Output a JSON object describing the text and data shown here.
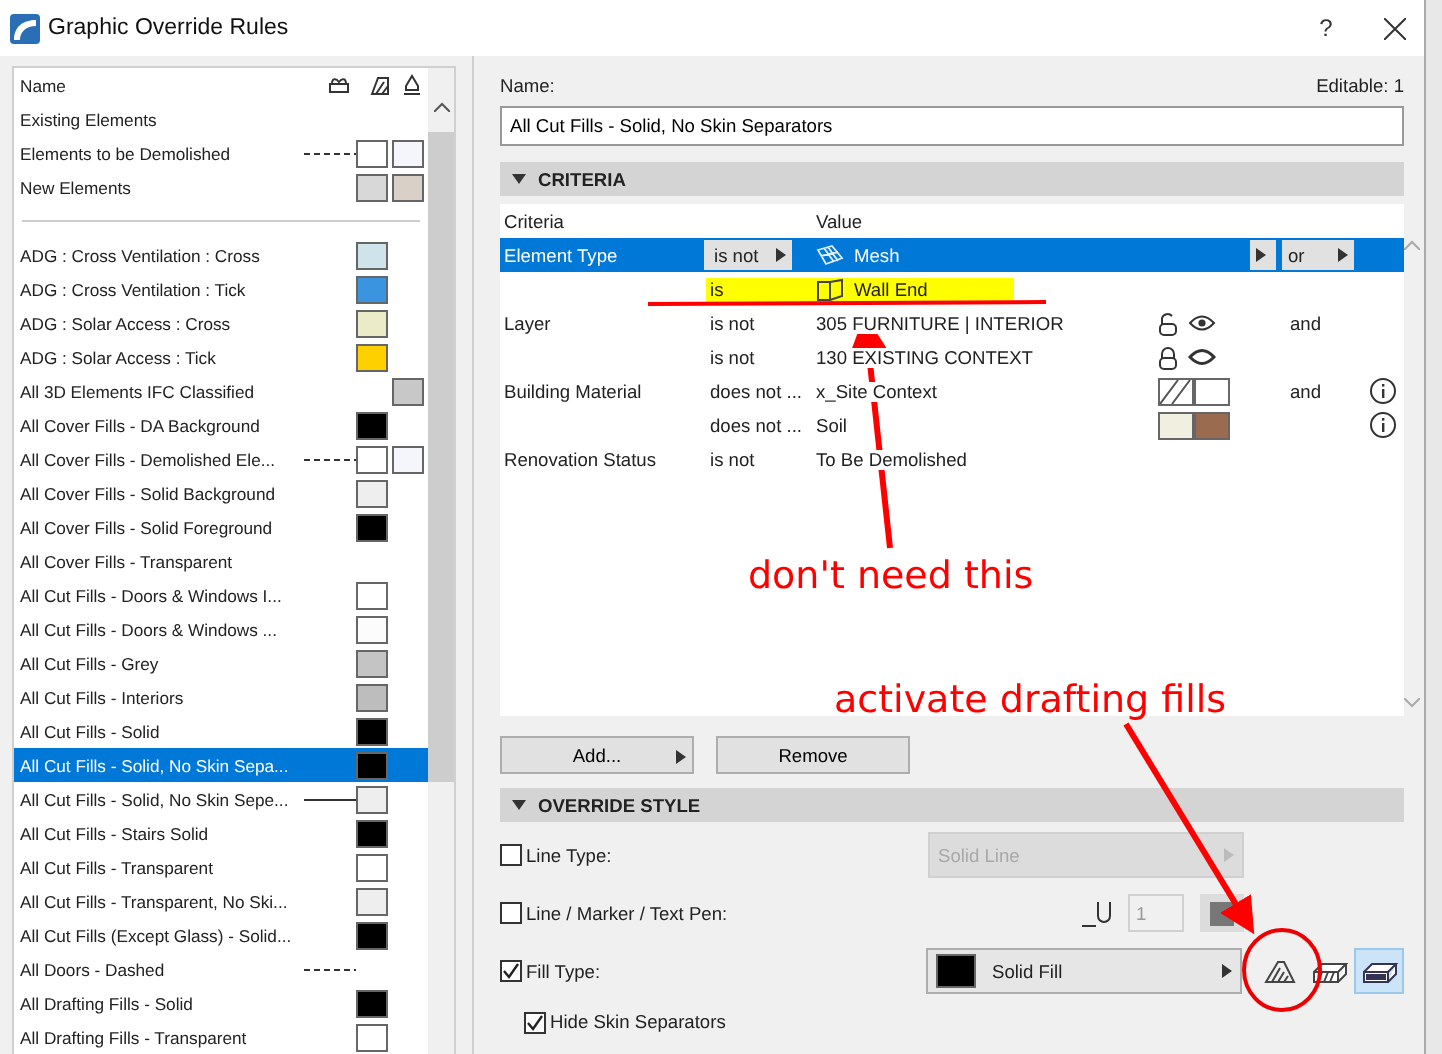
{
  "window": {
    "title": "Graphic Override Rules",
    "help": "?"
  },
  "rules_list": {
    "name_header": "Name",
    "items": [
      {
        "kind": "rule",
        "name": "Existing Elements",
        "selected": false
      },
      {
        "kind": "rule-dashed",
        "name": "Elements to be Demolished",
        "selected": false,
        "fills": [
          {
            "color": "#ffffff"
          },
          {
            "color": "#f4f6fb"
          }
        ]
      },
      {
        "kind": "rule",
        "name": "New Elements",
        "selected": false,
        "fills": [
          {
            "color": "#d8d8d8"
          },
          {
            "color": "#d9d0c8"
          }
        ]
      },
      {
        "kind": "separator"
      },
      {
        "kind": "rule",
        "name": "ADG : Cross Ventilation : Cross",
        "selected": false,
        "fills": [
          {
            "color": "#cfe3ea"
          }
        ]
      },
      {
        "kind": "rule",
        "name": "ADG : Cross Ventilation : Tick",
        "selected": false,
        "fills": [
          {
            "color": "#3a94e0"
          }
        ]
      },
      {
        "kind": "rule",
        "name": "ADG : Solar Access : Cross",
        "selected": false,
        "fills": [
          {
            "color": "#ecebc8"
          }
        ]
      },
      {
        "kind": "rule",
        "name": "ADG : Solar Access : Tick",
        "selected": false,
        "fills": [
          {
            "color": "#ffd000"
          }
        ]
      },
      {
        "kind": "rule",
        "name": "All 3D Elements IFC Classified",
        "selected": false,
        "fills": [
          {
            "kind": "blank"
          },
          {
            "color": "#c8c8c8"
          }
        ]
      },
      {
        "kind": "rule",
        "name": "All Cover Fills - DA Background",
        "selected": false,
        "fills": [
          {
            "color": "#000000"
          }
        ]
      },
      {
        "kind": "rule-dashed",
        "name": "All Cover Fills - Demolished Ele...",
        "selected": false,
        "fills": [
          {
            "color": "#ffffff"
          },
          {
            "color": "#f4f6fb"
          }
        ]
      },
      {
        "kind": "rule",
        "name": "All Cover Fills - Solid Background",
        "selected": false,
        "fills": [
          {
            "color": "#eeeeee"
          }
        ]
      },
      {
        "kind": "rule",
        "name": "All Cover Fills - Solid Foreground",
        "selected": false,
        "fills": [
          {
            "color": "#000000"
          }
        ]
      },
      {
        "kind": "rule",
        "name": "All Cover Fills - Transparent",
        "selected": false
      },
      {
        "kind": "rule",
        "name": "All Cut Fills - Doors & Windows I...",
        "selected": false,
        "fills": [
          {
            "color": "#ffffff"
          }
        ]
      },
      {
        "kind": "rule",
        "name": "All Cut Fills - Doors & Windows ...",
        "selected": false,
        "fills": [
          {
            "color": "#fcfcfc"
          }
        ]
      },
      {
        "kind": "rule",
        "name": "All Cut Fills - Grey",
        "selected": false,
        "fills": [
          {
            "color": "#c4c4c4"
          }
        ]
      },
      {
        "kind": "rule",
        "name": "All Cut Fills - Interiors",
        "selected": false,
        "fills": [
          {
            "color": "#bdbdbd"
          }
        ]
      },
      {
        "kind": "rule",
        "name": "All Cut Fills - Solid",
        "selected": false,
        "fills": [
          {
            "color": "#000000"
          }
        ]
      },
      {
        "kind": "rule",
        "name": "All Cut Fills - Solid, No Skin Sepa...",
        "selected": true,
        "fills": [
          {
            "color": "#000000"
          }
        ]
      },
      {
        "kind": "rule-solid",
        "name": "All Cut Fills - Solid, No Skin Sepe...",
        "selected": false,
        "fills": [
          {
            "color": "#eeeeee"
          }
        ]
      },
      {
        "kind": "rule",
        "name": "All Cut Fills - Stairs Solid",
        "selected": false,
        "fills": [
          {
            "color": "#000000"
          }
        ]
      },
      {
        "kind": "rule",
        "name": "All Cut Fills - Transparent",
        "selected": false,
        "fills": [
          {
            "color": "#ffffff"
          }
        ]
      },
      {
        "kind": "rule",
        "name": "All Cut Fills - Transparent, No Ski...",
        "selected": false,
        "fills": [
          {
            "color": "#eeeeee"
          }
        ]
      },
      {
        "kind": "rule",
        "name": "All Cut Fills (Except Glass) - Solid...",
        "selected": false,
        "fills": [
          {
            "color": "#000000"
          }
        ]
      },
      {
        "kind": "rule-dashed",
        "name": "All Doors - Dashed",
        "selected": false
      },
      {
        "kind": "rule",
        "name": "All Drafting Fills - Solid",
        "selected": false,
        "fills": [
          {
            "color": "#000000"
          }
        ]
      },
      {
        "kind": "rule",
        "name": "All Drafting Fills - Transparent",
        "selected": false,
        "fills": [
          {
            "color": "#ffffff"
          }
        ]
      }
    ]
  },
  "name_field": {
    "label": "Name:",
    "value": "All Cut Fills - Solid, No Skin Separators",
    "editable": "Editable: 1"
  },
  "criteria": {
    "title": "CRITERIA",
    "expanded": true,
    "columns": [
      "Criteria",
      "Value"
    ],
    "rows": [
      {
        "kind": "mesh",
        "criteria": "Element Type",
        "operator": "is not",
        "value": "Mesh",
        "conjunction": "or",
        "selected": true
      },
      {
        "kind": "wall-end",
        "operator": "is",
        "value": "Wall End",
        "selected": false
      },
      {
        "kind": "layer",
        "criteria": "Layer",
        "operator": "is not",
        "value": "305 FURNITURE | INTERIOR",
        "locked": false,
        "visible": true,
        "conjunction": "and",
        "selected": false
      },
      {
        "kind": "layer",
        "operator": "is not",
        "value": "130 EXISTING CONTEXT",
        "locked": true,
        "visible": false,
        "selected": false
      },
      {
        "kind": "material",
        "criteria": "Building Material",
        "operator": "does not ...",
        "value": "x_Site Context",
        "swatches": [
          {
            "color": "#ffffff",
            "kind": "hatch"
          },
          {
            "color": "#ffffff",
            "kind": "plain"
          }
        ],
        "conjunction": "and",
        "info": true,
        "selected": false
      },
      {
        "kind": "material",
        "operator": "does not ...",
        "value": "Soil",
        "swatches": [
          {
            "color": "#f1efe0",
            "kind": "plain"
          },
          {
            "color": "#9b6b4f",
            "kind": "plain"
          }
        ],
        "info": true,
        "selected": false
      },
      {
        "kind": "plain",
        "criteria": "Renovation Status",
        "operator": "is not",
        "value": "To Be Demolished",
        "selected": false
      }
    ]
  },
  "buttons": [
    "Add...",
    "Remove"
  ],
  "override_style": {
    "title": "OVERRIDE STYLE",
    "expanded": true,
    "line_type": {
      "label": "Line Type:",
      "checked": false,
      "value": "Solid Line"
    },
    "pen": {
      "label": "Line / Marker / Text Pen:",
      "checked": false,
      "value": "1"
    },
    "fill_type": {
      "label": "Fill Type:",
      "checked": true,
      "value": "Solid Fill",
      "color": "#000000"
    },
    "fill_modes": [
      {
        "kind": "drafting",
        "selected": false
      },
      {
        "kind": "cut",
        "selected": false
      },
      {
        "kind": "cover",
        "selected": true
      }
    ],
    "hide_skin_separators": {
      "label": "Hide Skin Separators",
      "checked": true
    }
  },
  "annotations": [
    {
      "text": "don't need this"
    },
    {
      "text": "activate drafting fills"
    }
  ]
}
